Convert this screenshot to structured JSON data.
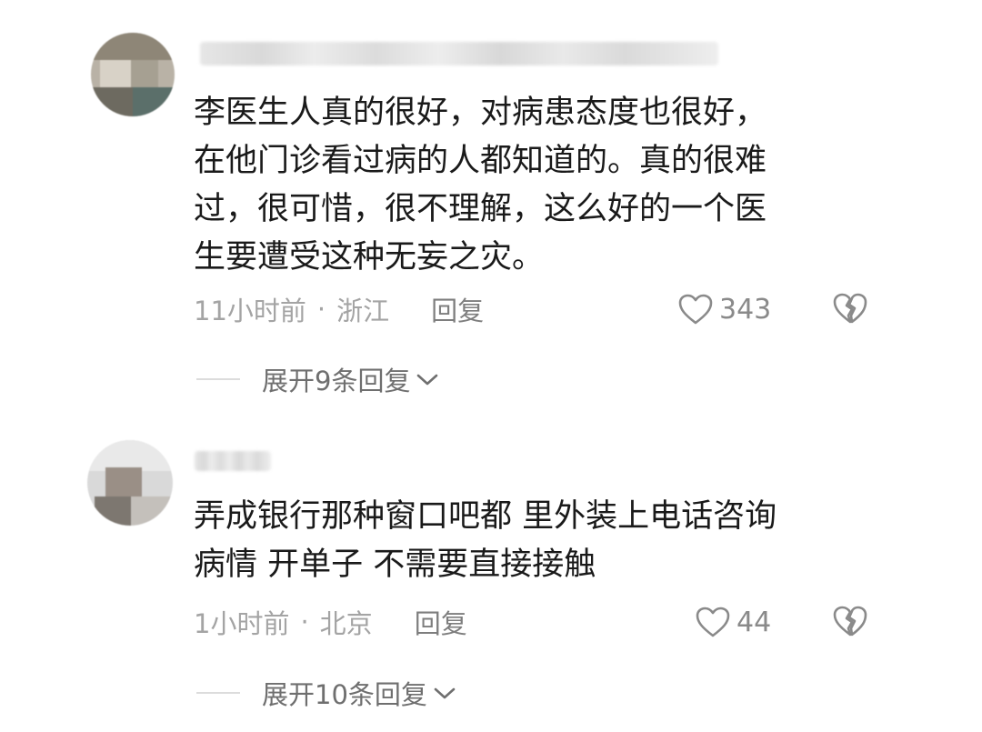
{
  "comments": [
    {
      "text_lines": [
        "李医生人真的很好，对病患态度也很好，",
        "在他门诊看过病的人都知道的。真的很难",
        "过，很可惜，很不理解，这么好的一个医",
        "生要遭受这种无妄之灾。"
      ],
      "time": "11小时前",
      "separator": "·",
      "location": "浙江",
      "reply_label": "回复",
      "like_count": "343",
      "expand_label": "展开9条回复"
    },
    {
      "text_lines": [
        "弄成银行那种窗口吧都 里外装上电话咨询",
        "病情 开单子 不需要直接接触"
      ],
      "time": "1小时前",
      "separator": "·",
      "location": "北京",
      "reply_label": "回复",
      "like_count": "44",
      "expand_label": "展开10条回复"
    }
  ],
  "icons": {
    "like": "heart-outline-icon",
    "dislike": "broken-heart-icon",
    "expand": "chevron-down-icon"
  },
  "colors": {
    "text": "#1a1a1a",
    "meta": "#a4a4a4",
    "action": "#7e7e7e"
  }
}
